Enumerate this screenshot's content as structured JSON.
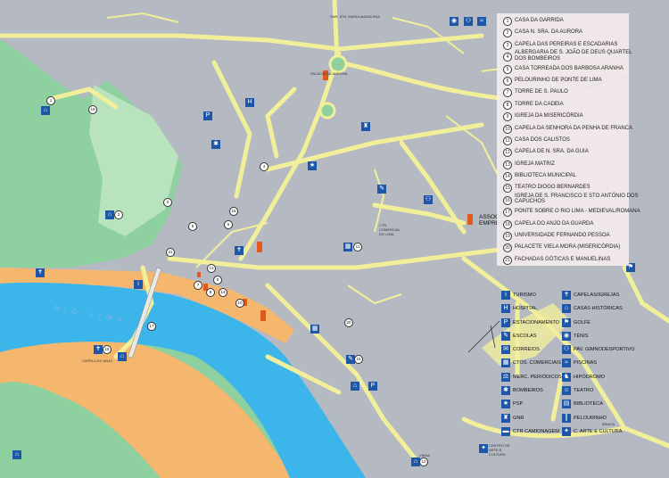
{
  "numbered_places": [
    {
      "n": "1",
      "label": "CASA DA GARRIDA"
    },
    {
      "n": "2",
      "label": "CASA N. SRA. DA AURORA"
    },
    {
      "n": "3",
      "label": "CAPELA DAS PEREIRAS E ESCADARIAS"
    },
    {
      "n": "4",
      "label": "ALBERGARIA DE S. JOÃO DE DEUS QUARTEL DOS BOMBEIROS"
    },
    {
      "n": "5",
      "label": "CASA TORREADA DOS BARBOSA ARANHA"
    },
    {
      "n": "6",
      "label": "PELOURINHO DE PONTE DE LIMA"
    },
    {
      "n": "7",
      "label": "TORRE DE S. PAULO"
    },
    {
      "n": "8",
      "label": "TORRE DA CADEIA"
    },
    {
      "n": "9",
      "label": "IGREJA DA MISERICÓRDIA"
    },
    {
      "n": "10",
      "label": "CAPELA DA SENHORA DA PENHA DE FRANCA"
    },
    {
      "n": "11",
      "label": "CASA DOS CALISTOS"
    },
    {
      "n": "12",
      "label": "CAPELA DE N. SRA. DA GUIA"
    },
    {
      "n": "13",
      "label": "IGREJA MATRIZ"
    },
    {
      "n": "14",
      "label": "BIBLIOTECA MUNICIPAL"
    },
    {
      "n": "15",
      "label": "TEATRO DIOGO BERNARDES"
    },
    {
      "n": "16",
      "label": "IGREJA DE S. FRANCISCO E STO ANTÓNIO DOS CAPUCHOS"
    },
    {
      "n": "17",
      "label": "PONTE SOBRE O RIO LIMA - MEDIEVAL/ROMANA"
    },
    {
      "n": "18",
      "label": "CAPELA DO ANJO DA GUARDA"
    },
    {
      "n": "19",
      "label": "UNIVERSIDADE FERNANDO PESSOA"
    },
    {
      "n": "20",
      "label": "PALACETE VIELA MORA (MISERICÓRDIA)"
    },
    {
      "n": "21",
      "label": "FACHADAS GÓTICAS E MANUELINAS"
    }
  ],
  "icon_legend_left": [
    {
      "icon": "turismo-icon",
      "glyph": "i",
      "label": "TURISMO"
    },
    {
      "icon": "hospital-icon",
      "glyph": "H",
      "label": "HOSPITAL"
    },
    {
      "icon": "parking-icon",
      "glyph": "P",
      "label": "ESTACIONAMENTO"
    },
    {
      "icon": "school-icon",
      "glyph": "✎",
      "label": "ESCOLAS"
    },
    {
      "icon": "post-icon",
      "glyph": "✉",
      "label": "CORREIOS"
    },
    {
      "icon": "shopping-icon",
      "glyph": "▦",
      "label": "CTOS. COMERCIAIS"
    },
    {
      "icon": "market-icon",
      "glyph": "⚖",
      "label": "MERC. PERIÓDICOS"
    },
    {
      "icon": "fire-icon",
      "glyph": "✱",
      "label": "BOMBEIROS"
    },
    {
      "icon": "police-icon",
      "glyph": "★",
      "label": "PSP"
    },
    {
      "icon": "gnr-icon",
      "glyph": "♜",
      "label": "GNR"
    },
    {
      "icon": "bus-icon",
      "glyph": "▬",
      "label": "CTR CAMIONAGEM"
    }
  ],
  "icon_legend_right": [
    {
      "icon": "chapel-icon",
      "glyph": "✝",
      "label": "CAPELAS/IGREJAS"
    },
    {
      "icon": "historic-house-icon",
      "glyph": "⌂",
      "label": "CASAS HISTÓRICAS"
    },
    {
      "icon": "golf-icon",
      "glyph": "⚑",
      "label": "GOLFE"
    },
    {
      "icon": "tennis-icon",
      "glyph": "◉",
      "label": "TÉNIS"
    },
    {
      "icon": "gym-icon",
      "glyph": "⚇",
      "label": "PAV. GIMNODESPORTIVO"
    },
    {
      "icon": "pool-icon",
      "glyph": "≈",
      "label": "PISCINAS"
    },
    {
      "icon": "hippodrome-icon",
      "glyph": "♞",
      "label": "HIPÓDROMO"
    },
    {
      "icon": "theatre-icon",
      "glyph": "☺",
      "label": "TEATRO"
    },
    {
      "icon": "library-icon",
      "glyph": "▤",
      "label": "BIBLIOTECA"
    },
    {
      "icon": "pillory-icon",
      "glyph": "┃",
      "label": "PELOURINHO"
    },
    {
      "icon": "culture-icon",
      "glyph": "✦",
      "label": "C. ARTE E CULTURA"
    }
  ],
  "map_labels": {
    "assoc": "ASSOCIA EMPRES",
    "river": "RIO LIMA",
    "centro_arte": "CENTRO DE ARTE E CULTURA",
    "braga": "BRAGA",
    "viana": "VIANA",
    "capela_anjo": "CAPELA DO ANJO",
    "centro_coml": "CTR. COMERCIAL DO LIMA",
    "palacio_aurora": "PALÁCIO DA AURORA",
    "sta_maria": "SNR. STA. MARIA MADALENA"
  },
  "map_numbers": [
    {
      "n": "1"
    },
    {
      "n": "2"
    },
    {
      "n": "3"
    },
    {
      "n": "4"
    },
    {
      "n": "5"
    },
    {
      "n": "6"
    },
    {
      "n": "7"
    },
    {
      "n": "8"
    },
    {
      "n": "9"
    },
    {
      "n": "10"
    },
    {
      "n": "11"
    },
    {
      "n": "12"
    },
    {
      "n": "13"
    },
    {
      "n": "14"
    },
    {
      "n": "15"
    },
    {
      "n": "16"
    },
    {
      "n": "17"
    },
    {
      "n": "18"
    },
    {
      "n": "19"
    },
    {
      "n": "20"
    },
    {
      "n": "21"
    }
  ],
  "colors": {
    "background": "#b4b9c2",
    "green": "#8fd0a0",
    "light_green": "#b9e2bf",
    "sand": "#f5b66e",
    "water": "#3cb6ea",
    "road": "#f2ef9a",
    "icon_blue": "#1f57a8",
    "monument": "#e05a1e"
  }
}
